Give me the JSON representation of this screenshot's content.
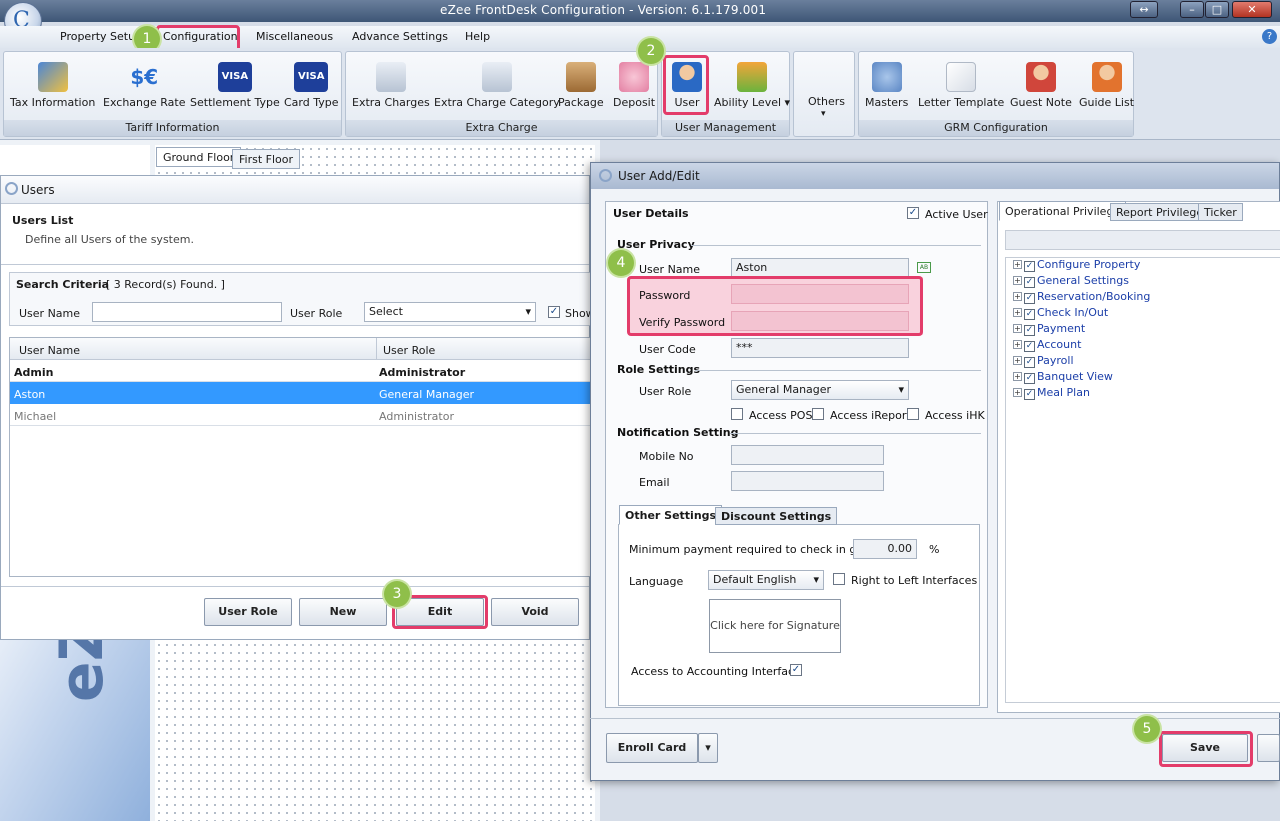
{
  "app": {
    "title": "eZee FrontDesk Configuration - Version: 6.1.179.001"
  },
  "menu": [
    "Property Setup",
    "Configuration",
    "Miscellaneous",
    "Advance Settings",
    "Help"
  ],
  "ribbon": {
    "tariff": {
      "label": "Tariff Information",
      "buttons": [
        "Tax Information",
        "Exchange Rate",
        "Settlement Type",
        "Card Type"
      ]
    },
    "extra": {
      "label": "Extra Charge",
      "buttons": [
        "Extra Charges",
        "Extra Charge Category",
        "Package",
        "Deposit"
      ]
    },
    "user_mgmt": {
      "label": "User Management",
      "buttons": [
        "User",
        "Ability Level"
      ]
    },
    "others": "Others",
    "grm": {
      "label": "GRM Configuration",
      "buttons": [
        "Masters",
        "Letter Template",
        "Guest Note",
        "Guide List"
      ]
    }
  },
  "floors": [
    "Ground Floor",
    "First Floor"
  ],
  "users_panel": {
    "title": "Users",
    "list_title": "Users List",
    "list_desc": "Define all Users of the system.",
    "search_label": "Search Criteria",
    "records": "[ 3 Record(s) Found. ]",
    "user_name_label": "User Name",
    "user_role_label": "User Role",
    "role_select": "Select",
    "show_label": "Show",
    "columns": [
      "User Name",
      "User Role"
    ],
    "rows": [
      [
        "Admin",
        "Administrator"
      ],
      [
        "Aston",
        "General Manager"
      ],
      [
        "Michael",
        "Administrator"
      ]
    ],
    "buttons": [
      "User Role",
      "New",
      "Edit",
      "Void"
    ]
  },
  "dialog": {
    "title": "User Add/Edit",
    "user_details": "User Details",
    "active_user": "Active User",
    "user_privacy": "User Privacy",
    "user_name_label": "User Name",
    "user_name_value": "Aston",
    "password_label": "Password",
    "verify_password_label": "Verify Password",
    "user_code_label": "User Code",
    "user_code_value": "***",
    "role_settings": "Role Settings",
    "user_role_label": "User Role",
    "user_role_value": "General Manager",
    "access_pos": "Access POS",
    "access_ireport": "Access iReport",
    "access_ihk": "Access iHK",
    "notification_setting": "Notification Setting",
    "mobile_label": "Mobile No",
    "email_label": "Email",
    "tab_other": "Other Settings",
    "tab_discount": "Discount Settings",
    "min_payment_label": "Minimum payment required to check in guest",
    "min_payment_value": "0.00",
    "percent": "%",
    "language_label": "Language",
    "language_value": "Default English",
    "rtl_label": "Right to Left Interfaces",
    "signature": "Click here for Signature",
    "accounting_label": "Access to Accounting Interface",
    "priv_tabs": [
      "Operational Privilege",
      "Report Privilege",
      "Ticker"
    ],
    "privileges": [
      "Configure Property",
      "General Settings",
      "Reservation/Booking",
      "Check In/Out",
      "Payment",
      "Account",
      "Payroll",
      "Banquet View",
      "Meal Plan"
    ],
    "enroll_card": "Enroll Card",
    "save": "Save"
  },
  "steps": [
    "1",
    "2",
    "3",
    "4",
    "5"
  ],
  "colors": {
    "accent": "#e33c6a",
    "badge": "#8fbf4a",
    "selected_row": "#3399ff"
  }
}
